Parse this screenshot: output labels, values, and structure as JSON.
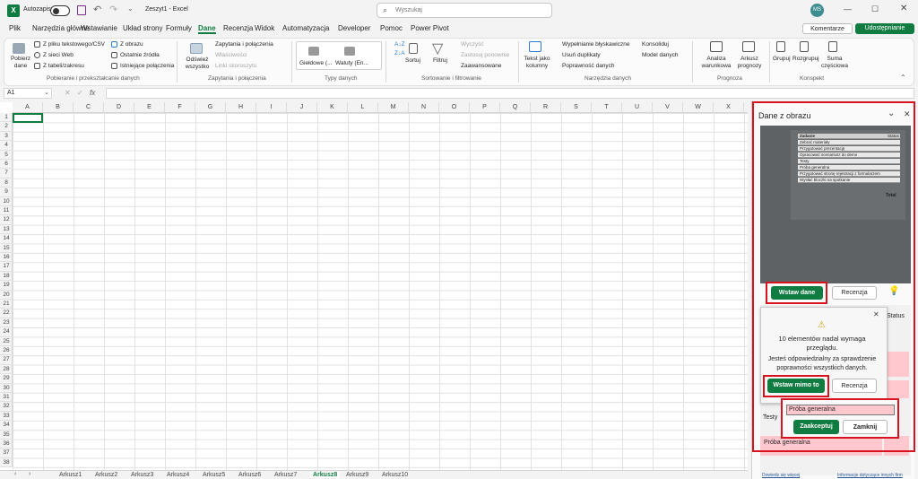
{
  "titlebar": {
    "autosave_label": "Autozapis",
    "doc_title": "Zeszyt1 - Excel",
    "search_placeholder": "Wyszukaj",
    "avatar_initials": "MS"
  },
  "menu": {
    "items": [
      "Plik",
      "Narzędzia główne",
      "Wstawianie",
      "Układ strony",
      "Formuły",
      "Dane",
      "Recenzja",
      "Widok",
      "Automatyzacja",
      "Developer",
      "Pomoc",
      "Power Pivot"
    ],
    "active": "Dane",
    "comments_label": "Komentarze",
    "share_label": "Udostępnianie"
  },
  "ribbon": {
    "get_data": "Pobierz dane",
    "from_text_csv": "Z pliku tekstowego/CSV",
    "from_web": "Z sieci Web",
    "from_table": "Z tabeli/zakresu",
    "from_picture": "Z obrazu",
    "recent_sources": "Ostatnie źródła",
    "existing_connections": "Istniejące połączenia",
    "group_get_transform": "Pobieranie i przekształcanie danych",
    "refresh_all": "Odśwież wszystko",
    "queries_connections": "Zapytania i połączenia",
    "properties": "Właściwości",
    "workbook_links": "Linki skoroszytu",
    "group_queries": "Zapytania i połączenia",
    "stocks": "Giełdowe (...",
    "currencies": "Waluty (En...",
    "group_data_types": "Typy danych",
    "sort": "Sortuj",
    "filter": "Filtruj",
    "clear": "Wyczyść",
    "reapply": "Zastosuj ponownie",
    "advanced": "Zaawansowane",
    "group_sort_filter": "Sortowanie i filtrowanie",
    "text_to_columns": "Tekst jako kolumny",
    "flash_fill": "Wypełnianie błyskawiczne",
    "remove_duplicates": "Usuń duplikaty",
    "data_validation": "Poprawność danych",
    "consolidate": "Konsoliduj",
    "data_model": "Model danych",
    "group_data_tools": "Narzędzia danych",
    "what_if": "Analiza warunkowa",
    "forecast_sheet": "Arkusz prognozy",
    "group_forecast": "Prognoza",
    "group_btn": "Grupuj",
    "ungroup_btn": "Rozgrupuj",
    "subtotal": "Suma częściowa",
    "group_outline": "Konspekt"
  },
  "formula_bar": {
    "name_box": "A1",
    "fx": "fx",
    "value": ""
  },
  "grid": {
    "columns": [
      "A",
      "B",
      "C",
      "D",
      "E",
      "F",
      "G",
      "H",
      "I",
      "J",
      "K",
      "L",
      "M",
      "N",
      "O",
      "P",
      "Q",
      "R",
      "S",
      "T",
      "U",
      "V",
      "W",
      "X"
    ],
    "rows": [
      "1",
      "2",
      "3",
      "4",
      "5",
      "6",
      "7",
      "8",
      "9",
      "10",
      "11",
      "12",
      "13",
      "14",
      "15",
      "16",
      "17",
      "18",
      "19",
      "20",
      "21",
      "22",
      "23",
      "24",
      "25",
      "26",
      "27",
      "28",
      "29",
      "30",
      "31",
      "32",
      "33",
      "34",
      "35",
      "36",
      "37",
      "38"
    ]
  },
  "sheets": {
    "tabs": [
      "Arkusz1",
      "Arkusz2",
      "Arkusz3",
      "Arkusz4",
      "Arkusz5",
      "Arkusz6",
      "Arkusz7",
      "Arkusz8",
      "Arkusz9",
      "Arkusz10"
    ],
    "active": "Arkusz8"
  },
  "panel": {
    "title": "Dane z obrazu",
    "preview_rows": [
      "Zadanie",
      "Zebrać materiały",
      "Przygotować prezentację",
      "Opracować scenariusz do demo",
      "Testy",
      "Próba generalna",
      "Przygotować stronę rejestracji z formularzem",
      "Wysłać bloczki na spotkanie"
    ],
    "preview_header_status": "Status",
    "preview_total": "Total",
    "insert_data": "Wstaw dane",
    "review": "Recenzja",
    "dialog_message_1": "10 elementów nadal wymaga przeglądu.",
    "dialog_message_2": "Jesteś odpowiedzialny za sprawdzenie poprawności wszystkich danych.",
    "insert_anyway": "Wstaw mimo to",
    "dialog_review": "Recenzja",
    "status_col": "Status",
    "testy_label": "Testy",
    "edit_value": "Próba generalna",
    "accept": "Zaakceptuj",
    "close": "Zamknij",
    "row_label": "Próba generalna",
    "footer_left": "Dowiedz się więcej",
    "footer_right": "Informacje dotyczące innych firm"
  },
  "colors": {
    "excel_green": "#107c41",
    "highlight_red": "#d8121e",
    "review_pink": "#ffc7ce"
  }
}
